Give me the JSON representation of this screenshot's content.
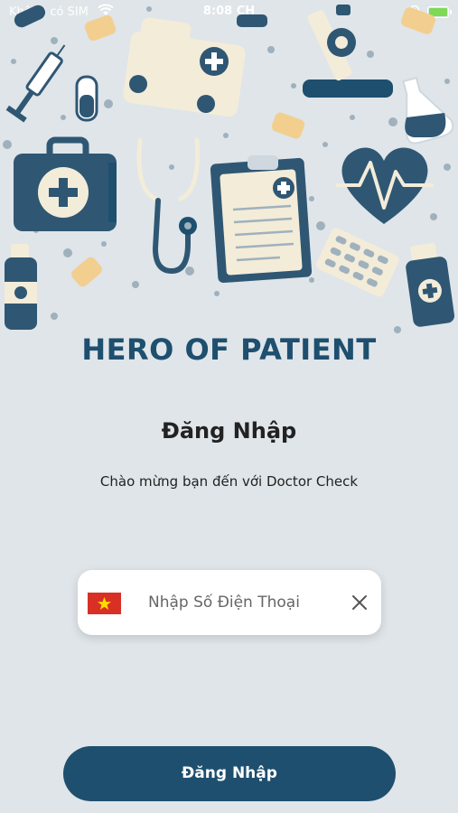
{
  "status_bar": {
    "carrier": "Không có SIM",
    "time": "8:08 CH"
  },
  "app": {
    "title": "HERO OF PATIENT"
  },
  "login": {
    "heading": "Đăng Nhập",
    "subtitle": "Chào mừng bạn đến với Doctor Check",
    "phone_placeholder": "Nhập Số Điện Thoại",
    "country": "VN",
    "button_label": "Đăng Nhập"
  },
  "colors": {
    "background": "#dfe5e9",
    "primary": "#1e4f6e",
    "accent_yellow": "#f2cf8f",
    "illustration_cream": "#f3ecd9"
  },
  "icons": [
    "wifi-icon",
    "location-icon",
    "battery-icon",
    "vietnam-flag-icon",
    "clear-icon"
  ]
}
